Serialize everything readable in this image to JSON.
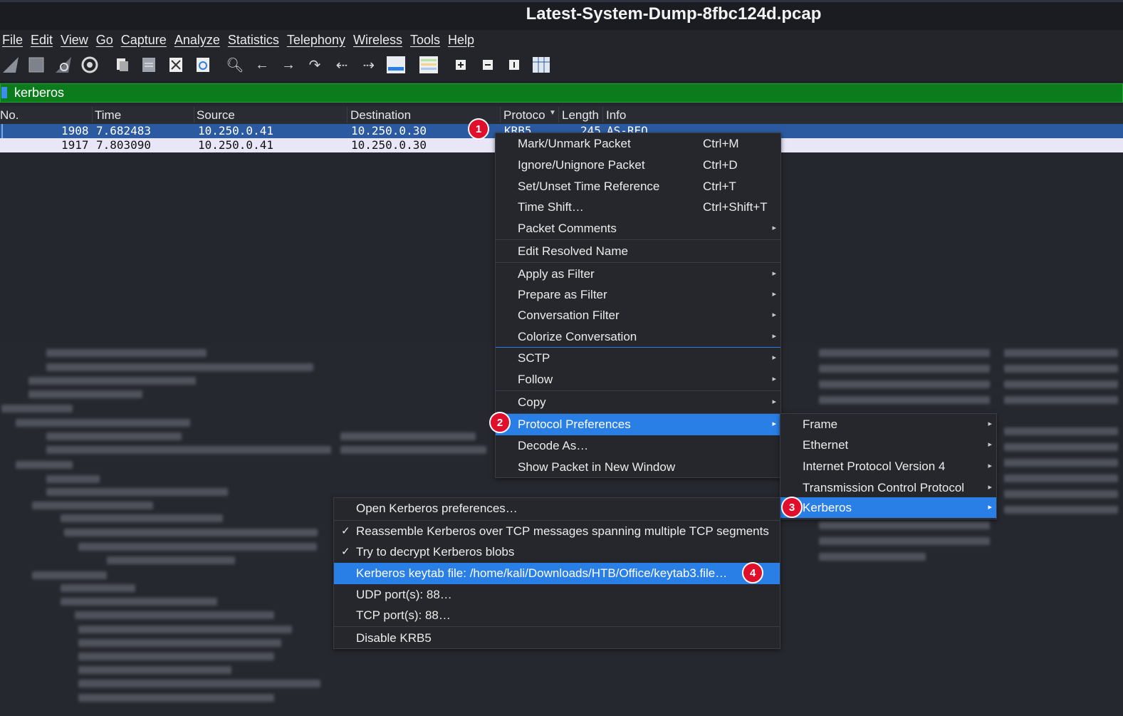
{
  "window": {
    "title": "Latest-System-Dump-8fbc124d.pcap"
  },
  "menubar": [
    "File",
    "Edit",
    "View",
    "Go",
    "Capture",
    "Analyze",
    "Statistics",
    "Telephony",
    "Wireless",
    "Tools",
    "Help"
  ],
  "filter": {
    "value": "kerberos"
  },
  "packet_list": {
    "columns": [
      "No.",
      "Time",
      "Source",
      "Destination",
      "Protoco",
      "Length",
      "Info"
    ],
    "rows": [
      {
        "no": "1908",
        "time": "7.682483",
        "source": "10.250.0.41",
        "destination": "10.250.0.30",
        "protocol": "KRB5",
        "length": "245",
        "info": "AS-REQ",
        "selected": true
      },
      {
        "no": "1917",
        "time": "7.803090",
        "source": "10.250.0.41",
        "destination": "10.250.0.30",
        "protocol": "",
        "length": "",
        "info": "",
        "selected": false
      }
    ]
  },
  "context_menu": {
    "items": [
      {
        "label": "Mark/Unmark Packet",
        "shortcut": "Ctrl+M"
      },
      {
        "label": "Ignore/Unignore Packet",
        "shortcut": "Ctrl+D"
      },
      {
        "label": "Set/Unset Time Reference",
        "shortcut": "Ctrl+T"
      },
      {
        "label": "Time Shift…",
        "shortcut": "Ctrl+Shift+T"
      },
      {
        "label": "Packet Comments",
        "shortcut": ""
      },
      {
        "label": "Edit Resolved Name",
        "shortcut": ""
      },
      {
        "label": "Apply as Filter",
        "shortcut": ""
      },
      {
        "label": "Prepare as Filter",
        "shortcut": ""
      },
      {
        "label": "Conversation Filter",
        "shortcut": ""
      },
      {
        "label": "Colorize Conversation",
        "shortcut": ""
      },
      {
        "label": "SCTP",
        "shortcut": ""
      },
      {
        "label": "Follow",
        "shortcut": ""
      },
      {
        "label": "Copy",
        "shortcut": ""
      },
      {
        "label": "Protocol Preferences",
        "shortcut": ""
      },
      {
        "label": "Decode As…",
        "shortcut": ""
      },
      {
        "label": "Show Packet in New Window",
        "shortcut": ""
      }
    ]
  },
  "protocol_submenu": {
    "items": [
      "Frame",
      "Ethernet",
      "Internet Protocol Version 4",
      "Transmission Control Protocol",
      "Kerberos"
    ]
  },
  "kerberos_submenu": {
    "items": [
      {
        "label": "Open Kerberos preferences…",
        "checked": false
      },
      {
        "label": "Reassemble Kerberos over TCP messages spanning multiple TCP segments",
        "checked": true,
        "check": "✓"
      },
      {
        "label": "Try to decrypt Kerberos blobs",
        "checked": true,
        "check": "✓"
      },
      {
        "label": "Kerberos keytab file: /home/kali/Downloads/HTB/Office/keytab3.file…",
        "checked": false
      },
      {
        "label": "UDP port(s): 88…",
        "checked": false
      },
      {
        "label": "TCP port(s): 88…",
        "checked": false
      },
      {
        "label": "Disable KRB5",
        "checked": false
      }
    ]
  },
  "badges": [
    "1",
    "2",
    "3",
    "4"
  ],
  "colors": {
    "accent": "#2a7fe6",
    "filter_ok": "#0c7b1b",
    "selected_row": "#2c5aa0",
    "badge": "#e0102c"
  }
}
